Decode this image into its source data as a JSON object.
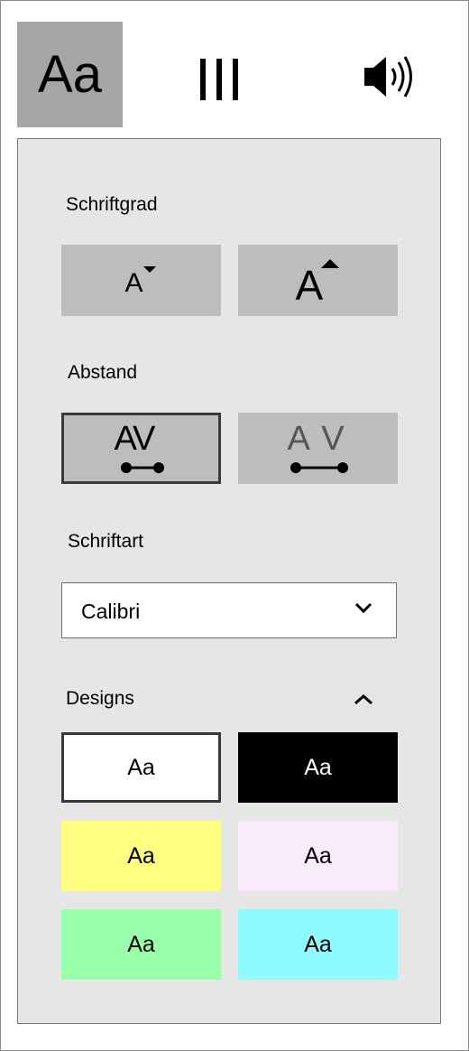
{
  "tabs": {
    "text_label": "Aa",
    "columns_label": "III"
  },
  "font_size": {
    "heading": "Schriftgrad",
    "decrease_glyph": "A",
    "increase_glyph": "A"
  },
  "spacing": {
    "heading": "Abstand",
    "narrow_glyph": "AV",
    "wide_glyph": "A V"
  },
  "font_family": {
    "heading": "Schriftart",
    "selected": "Calibri"
  },
  "themes": {
    "heading": "Designs",
    "items": [
      {
        "label": "Aa",
        "bg": "#ffffff",
        "fg": "#000000"
      },
      {
        "label": "Aa",
        "bg": "#000000",
        "fg": "#ffffff"
      },
      {
        "label": "Aa",
        "bg": "#ffff80",
        "fg": "#000000"
      },
      {
        "label": "Aa",
        "bg": "#f9ebfb",
        "fg": "#000000"
      },
      {
        "label": "Aa",
        "bg": "#99ffa8",
        "fg": "#000000"
      },
      {
        "label": "Aa",
        "bg": "#8ffbff",
        "fg": "#000000"
      }
    ]
  },
  "colors": {
    "panel_bg": "#e6e6e6",
    "button_bg": "#bdbdbd",
    "active_tab_bg": "#a6a6a6",
    "selected_border": "#3a3a3a"
  }
}
